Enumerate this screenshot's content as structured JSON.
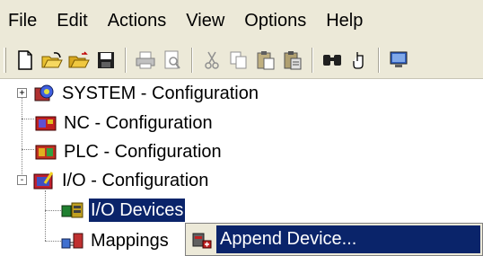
{
  "menubar": {
    "items": [
      "File",
      "Edit",
      "Actions",
      "View",
      "Options",
      "Help"
    ]
  },
  "toolbar": {
    "buttons": [
      "new-icon",
      "open-icon",
      "open-folder-icon",
      "save-icon",
      "print-icon",
      "print-preview-icon",
      "cut-icon",
      "copy-icon",
      "paste-icon",
      "paste-special-icon",
      "find-icon",
      "hand-icon",
      "monitor-icon"
    ]
  },
  "tree": {
    "nodes": [
      {
        "label": "SYSTEM - Configuration",
        "expander": "+"
      },
      {
        "label": "NC - Configuration"
      },
      {
        "label": "PLC - Configuration"
      },
      {
        "label": "I/O - Configuration",
        "expander": "-"
      },
      {
        "label": "I/O Devices"
      },
      {
        "label": "Mappings"
      }
    ]
  },
  "context_menu": {
    "items": [
      {
        "label": "Append Device..."
      }
    ]
  },
  "colors": {
    "chrome": "#ece9d8",
    "selection": "#0a246a"
  }
}
